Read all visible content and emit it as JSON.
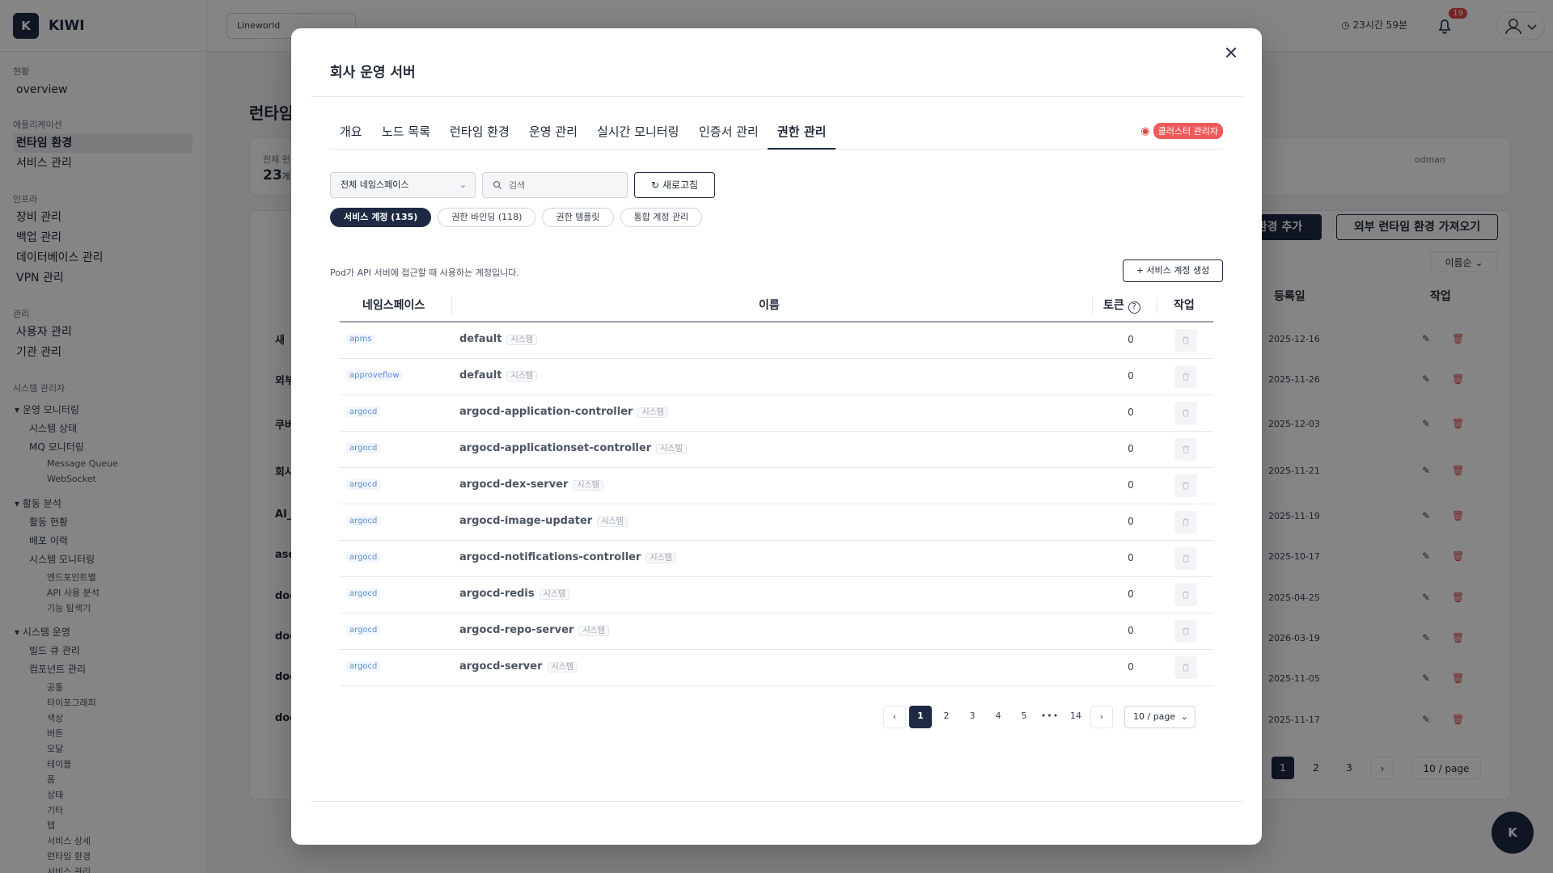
{
  "app": {
    "logo_letter": "K",
    "name": "KIWI"
  },
  "topbar": {
    "workspace": "Lineworld",
    "session_time": "23시간 59분",
    "notifications": "19"
  },
  "sidebar": {
    "sec_status": "현황",
    "overview": "overview",
    "sec_app": "애플리케이션",
    "runtime": "런타임 환경",
    "service": "서비스 관리",
    "sec_infra": "인프라",
    "equip": "장비 관리",
    "backup": "백업 관리",
    "db": "데이터베이스 관리",
    "vpn": "VPN 관리",
    "sec_mgmt": "관리",
    "users": "사용자 관리",
    "org": "기관 관리",
    "sec_sys": "시스템 관리자",
    "g1": "▾ 운영 모니터링",
    "g1a": "시스템 상태",
    "g1b": "MQ 모니터링",
    "g1c": "Message Queue",
    "g1d": "WebSocket",
    "g2": "▾ 활동 분석",
    "g2a": "활동 현황",
    "g2b": "배포 이력",
    "g2c": "시스템 모니터링",
    "g2d": "엔드포인트별",
    "g2e": "API 사용 분석",
    "g2f": "기능 탐색기",
    "g3": "▾ 시스템 운영",
    "g3a": "빌드 큐 관리",
    "g3b": "컴포넌트 관리",
    "g3c": "공통",
    "g3d": "타이포그래피",
    "g3e": "색상",
    "g3f": "버튼",
    "g3g": "모달",
    "g3h": "테이블",
    "g3i": "폼",
    "g3j": "상태",
    "g3k": "기타",
    "g3l": "탭",
    "g3m": "서비스 상세",
    "g3n": "런타임 환경",
    "g3o": "서비스 관리"
  },
  "background": {
    "title": "런타임",
    "card_label": "전체 런",
    "card_value": "23",
    "card_unit": "개",
    "card_right": "odman",
    "add_btn": "환경 추가",
    "import_btn": "외부 런타임 환경 가져오기",
    "sort": "이름순",
    "col_date": "등록일",
    "col_action": "작업",
    "rows": [
      {
        "name": "새",
        "date": "2025-12-16"
      },
      {
        "name": "외부",
        "date": "2025-11-26"
      },
      {
        "name": "쿠버",
        "date": "2025-12-03"
      },
      {
        "name": "회사",
        "date": "2025-11-21"
      },
      {
        "name": "AI_",
        "date": "2025-11-19"
      },
      {
        "name": "asd",
        "date": "2025-10-17"
      },
      {
        "name": "doc",
        "date": "2025-04-25"
      },
      {
        "name": "doc",
        "date": "2026-03-19"
      },
      {
        "name": "doc",
        "date": "2025-11-05"
      },
      {
        "name": "doc",
        "date": "2025-11-17"
      }
    ],
    "pages": [
      "1",
      "2",
      "3"
    ],
    "perpage": "10 / page",
    "fab": "K"
  },
  "modal": {
    "title": "회사 운영 서버",
    "tabs": [
      "개요",
      "노드 목록",
      "런타임 환경",
      "운영 관리",
      "실시간 모니터링",
      "인증서 관리",
      "권한 관리"
    ],
    "active_tab": "권한 관리",
    "role_badge": "클러스터 관리자",
    "namespace_filter": "전체 네임스페이스",
    "search_placeholder": "검색",
    "refresh": "새로고침",
    "chips": [
      "서비스 계정 (135)",
      "권한 바인딩 (118)",
      "권한 템플릿",
      "통합 계정 관리"
    ],
    "description": "Pod가 API 서버에 접근할 때 사용하는 계정입니다.",
    "create_btn": "+ 서비스 계정 생성",
    "columns": {
      "namespace": "네임스페이스",
      "name": "이름",
      "token": "토큰",
      "action": "작업"
    },
    "system_tag": "시스템",
    "rows": [
      {
        "ns": "apms",
        "name": "default",
        "token": "0"
      },
      {
        "ns": "approveflow",
        "name": "default",
        "token": "0"
      },
      {
        "ns": "argocd",
        "name": "argocd-application-controller",
        "token": "0"
      },
      {
        "ns": "argocd",
        "name": "argocd-applicationset-controller",
        "token": "0"
      },
      {
        "ns": "argocd",
        "name": "argocd-dex-server",
        "token": "0"
      },
      {
        "ns": "argocd",
        "name": "argocd-image-updater",
        "token": "0"
      },
      {
        "ns": "argocd",
        "name": "argocd-notifications-controller",
        "token": "0"
      },
      {
        "ns": "argocd",
        "name": "argocd-redis",
        "token": "0"
      },
      {
        "ns": "argocd",
        "name": "argocd-repo-server",
        "token": "0"
      },
      {
        "ns": "argocd",
        "name": "argocd-server",
        "token": "0"
      }
    ],
    "pagination": {
      "pages": [
        "1",
        "2",
        "3",
        "4",
        "5"
      ],
      "ellipsis": "•••",
      "last": "14",
      "perpage": "10 / page"
    }
  }
}
